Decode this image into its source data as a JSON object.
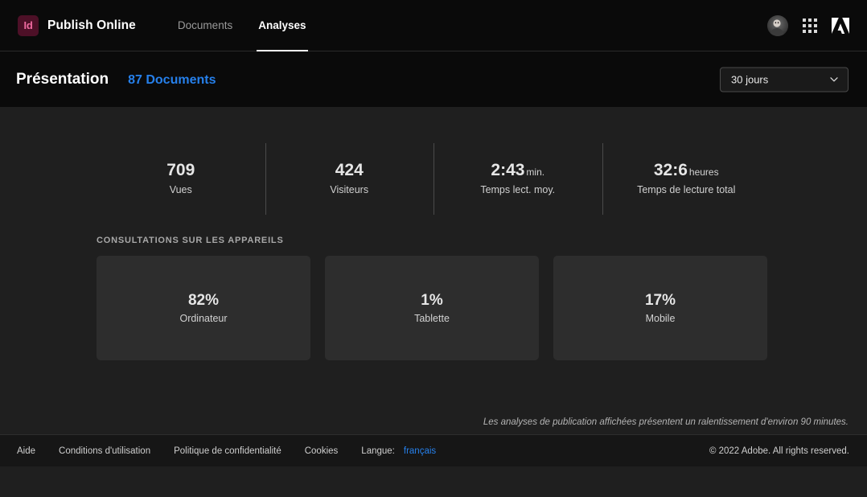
{
  "topbar": {
    "logo_text": "Id",
    "brand_name": "Publish Online",
    "tabs": [
      {
        "label": "Documents",
        "active": false
      },
      {
        "label": "Analyses",
        "active": true
      }
    ],
    "icons": {
      "avatar": "user-avatar",
      "apps": "app-grid-icon",
      "adobe": "adobe-logo-icon"
    }
  },
  "subheader": {
    "title": "Présentation",
    "doc_count_label": "87 Documents",
    "range_select": {
      "value": "30 jours",
      "chevron": "chevron-down-icon"
    }
  },
  "stats": [
    {
      "value": "709",
      "unit": "",
      "label": "Vues"
    },
    {
      "value": "424",
      "unit": "",
      "label": "Visiteurs"
    },
    {
      "value": "2:43",
      "unit": "min.",
      "label": "Temps lect. moy."
    },
    {
      "value": "32:6",
      "unit": "heures",
      "label": "Temps de lecture total"
    }
  ],
  "devices_section": {
    "title": "CONSULTATIONS SUR LES APPAREILS",
    "cards": [
      {
        "percent": "82%",
        "name": "Ordinateur"
      },
      {
        "percent": "1%",
        "name": "Tablette"
      },
      {
        "percent": "17%",
        "name": "Mobile"
      }
    ]
  },
  "note": "Les analyses de publication affichées présentent un ralentissement d'environ 90 minutes.",
  "footer": {
    "links": [
      "Aide",
      "Conditions d'utilisation",
      "Politique de confidentialité",
      "Cookies"
    ],
    "language_label": "Langue:",
    "language_value": "français",
    "copyright": "© 2022 Adobe. All rights reserved."
  },
  "colors": {
    "accent_blue": "#2680eb",
    "page_bg": "#1f1f1f",
    "header_bg": "#0a0a0a",
    "card_bg": "#2d2d2d",
    "indesign_maroon": "#4d1027",
    "indesign_pink": "#f06ba0"
  }
}
